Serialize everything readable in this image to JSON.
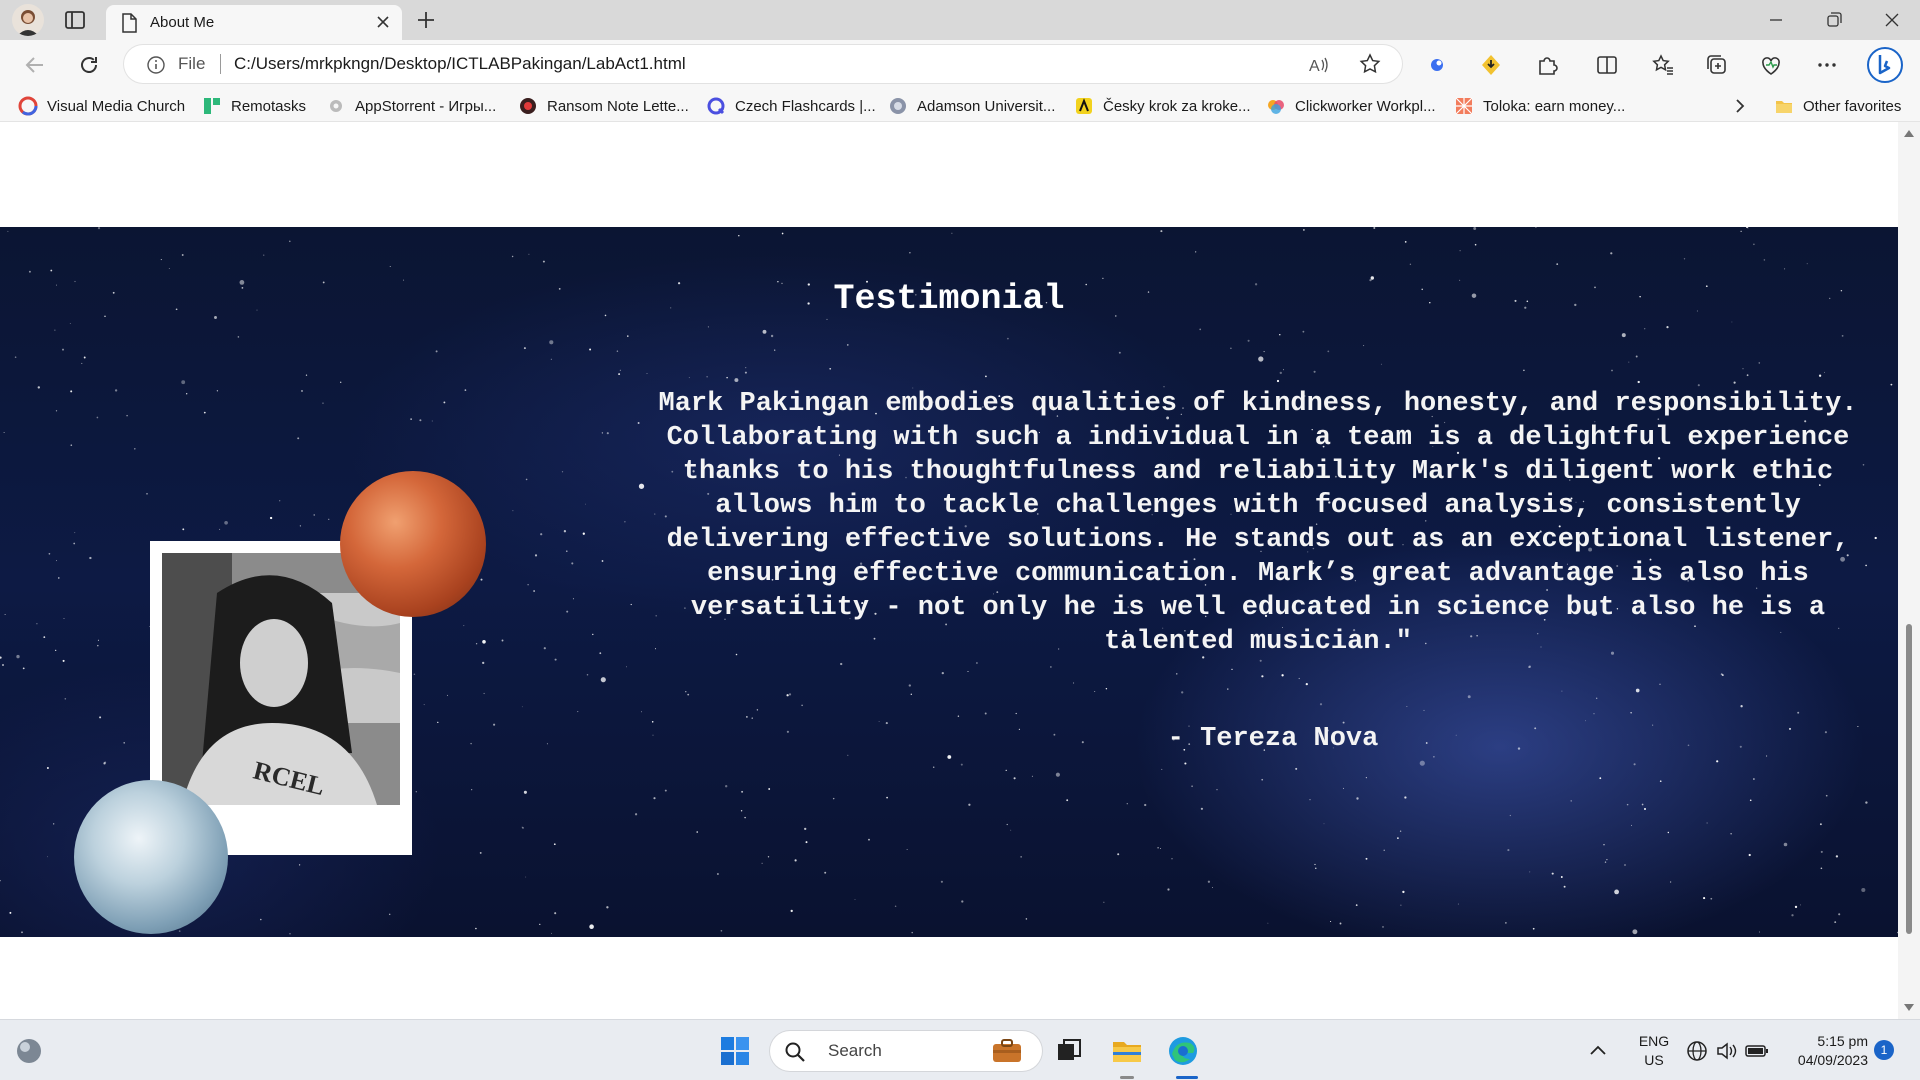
{
  "browser": {
    "tab_title": "About Me",
    "address_scheme": "File",
    "address_url": "C:/Users/mrkpkngn/Desktop/ICTLABPakingan/LabAct1.html",
    "accent": "#1a64c8"
  },
  "favorites": [
    {
      "label": "Visual Media Church",
      "icon": "church-icon"
    },
    {
      "label": "Remotasks",
      "icon": "remotasks-icon"
    },
    {
      "label": "AppStorrent - Игры...",
      "icon": "appstorrent-icon"
    },
    {
      "label": "Ransom Note Lette...",
      "icon": "ransom-icon"
    },
    {
      "label": "Czech Flashcards |...",
      "icon": "flashcards-icon"
    },
    {
      "label": "Adamson Universit...",
      "icon": "adamson-icon"
    },
    {
      "label": "Česky krok za kroke...",
      "icon": "czech-icon"
    },
    {
      "label": "Clickworker Workpl...",
      "icon": "clickworker-icon"
    },
    {
      "label": "Toloka: earn money...",
      "icon": "toloka-icon"
    }
  ],
  "favorites_other": "Other favorites",
  "page": {
    "section_title": "Testimonial",
    "quote": "Mark Pakingan embodies qualities of kindness, honesty, and responsibility. Collaborating with such a individual in a team is a delightful experience thanks to his thoughtfulness and reliability Mark's diligent work ethic allows him to tackle challenges with focused analysis, consistently delivering effective solutions. He stands out as an exceptional listener, ensuring effective communication. Mark’s great advantage is also his versatility - not only he is well educated in science but also he is a talented musician.\"",
    "author": "- Tereza Nova"
  },
  "taskbar": {
    "search_placeholder": "Search",
    "language": "ENG",
    "region": "US",
    "time": "5:15 pm",
    "date": "04/09/2023",
    "notification_count": "1"
  }
}
